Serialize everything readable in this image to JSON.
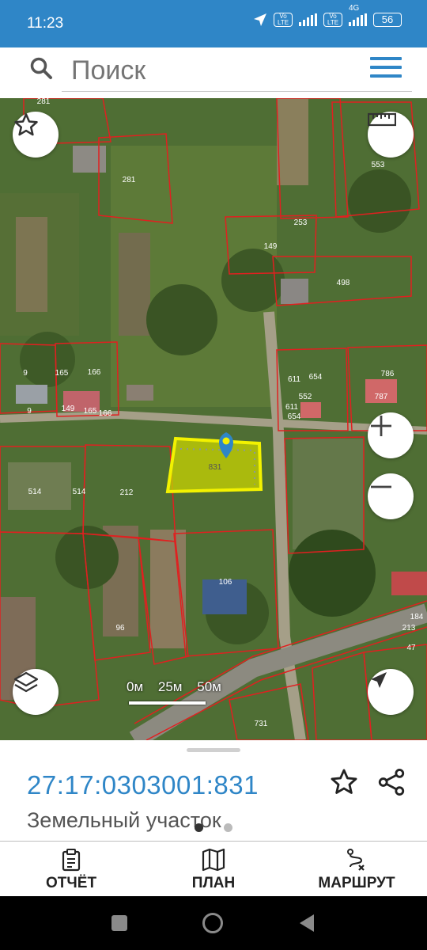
{
  "status_bar": {
    "time": "11:23",
    "volte1": "Vo LTE",
    "volte2": "Vo LTE",
    "network": "4G",
    "battery": "56"
  },
  "search": {
    "placeholder": "Поиск"
  },
  "map": {
    "parcel_labels": [
      "281",
      "281",
      "553",
      "149",
      "253",
      "498",
      "9",
      "9",
      "165",
      "166",
      "165",
      "166",
      "149",
      "611",
      "654",
      "611",
      "654",
      "552",
      "786",
      "787",
      "514",
      "514",
      "212",
      "831",
      "106",
      "96",
      "184",
      "213",
      "47",
      "731"
    ],
    "selected_parcel": "831",
    "scale": {
      "labels": [
        "0м",
        "25м",
        "50м"
      ]
    }
  },
  "parcel_sheet": {
    "cadastral_number": "27:17:0303001:831",
    "type": "Земельный участок",
    "page_dots": {
      "count": 2,
      "active": 0
    }
  },
  "bottom_nav": {
    "items": [
      {
        "label": "ОТЧЁТ",
        "icon": "clipboard-icon"
      },
      {
        "label": "ПЛАН",
        "icon": "map-icon"
      },
      {
        "label": "МАРШРУТ",
        "icon": "route-icon"
      }
    ]
  },
  "colors": {
    "accent": "#2f86c7",
    "parcel_border": "#e02020",
    "selected_parcel_fill": "#c8d400",
    "selected_parcel_border": "#f3f200"
  }
}
